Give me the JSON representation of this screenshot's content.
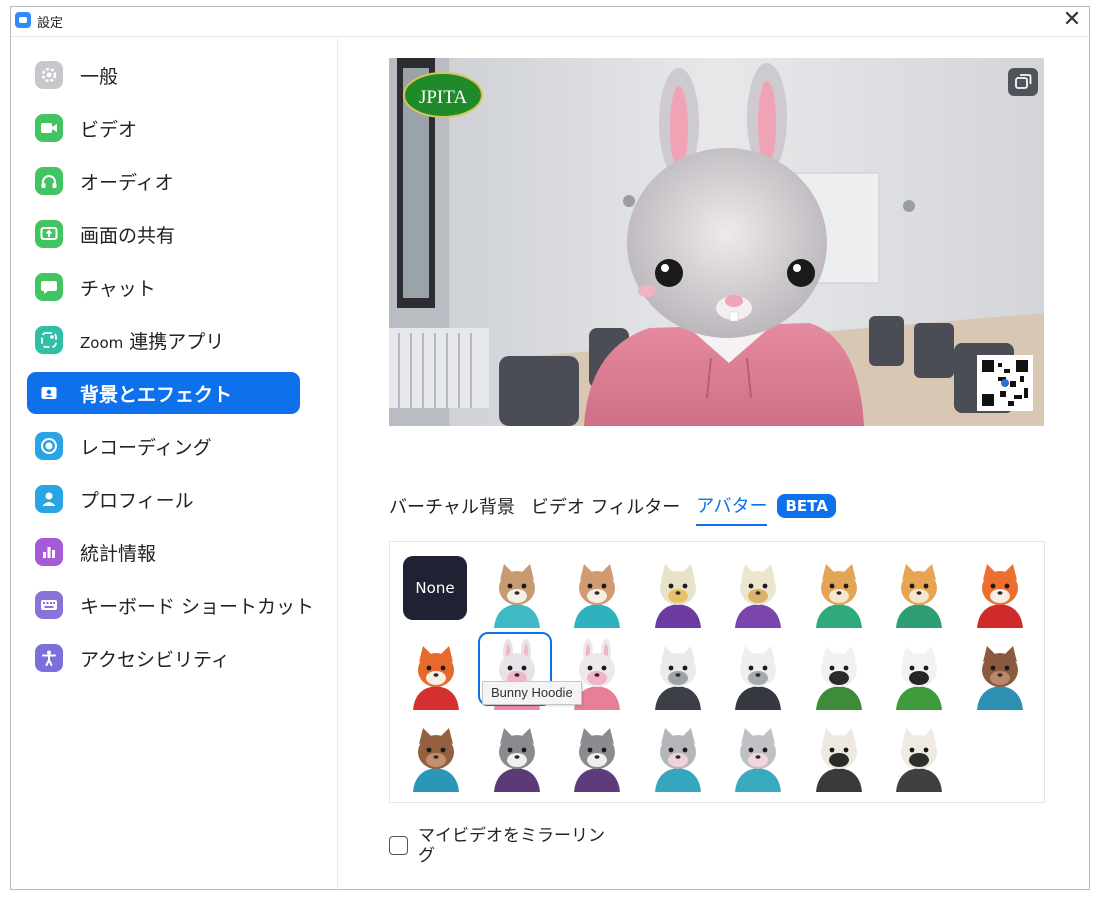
{
  "window": {
    "title": "設定",
    "close_glyph": "✕"
  },
  "sidebar": {
    "items": [
      {
        "id": "general",
        "label": "一般",
        "icon": "gear-icon",
        "color": "#c8c8cc"
      },
      {
        "id": "video",
        "label": "ビデオ",
        "icon": "video-camera-icon",
        "color": "#43c463"
      },
      {
        "id": "audio",
        "label": "オーディオ",
        "icon": "headphones-icon",
        "color": "#43c463"
      },
      {
        "id": "screen-share",
        "label": "画面の共有",
        "icon": "share-screen-icon",
        "color": "#43c463"
      },
      {
        "id": "chat",
        "label": "チャット",
        "icon": "chat-bubble-icon",
        "color": "#43c463"
      },
      {
        "id": "zoom-apps",
        "label_latin": "Zoom",
        "label": "連携アプリ",
        "icon": "apps-icon",
        "color": "#2fbfa6"
      },
      {
        "id": "background-effects",
        "label": "背景とエフェクト",
        "icon": "person-card-icon",
        "color": "#0e71eb",
        "active": true
      },
      {
        "id": "recording",
        "label": "レコーディング",
        "icon": "record-icon",
        "color": "#2ba4e6"
      },
      {
        "id": "profile",
        "label": "プロフィール",
        "icon": "profile-icon",
        "color": "#2ba4e6"
      },
      {
        "id": "statistics",
        "label": "統計情報",
        "icon": "bar-chart-icon",
        "color": "#a55bd6"
      },
      {
        "id": "keyboard-shortcuts",
        "label": "キーボード ショートカット",
        "icon": "keyboard-icon",
        "color": "#8a72d8"
      },
      {
        "id": "accessibility",
        "label": "アクセシビリティ",
        "icon": "accessibility-icon",
        "color": "#7b6fd9"
      }
    ]
  },
  "preview": {
    "logo_text": "JPITA",
    "pip_icon": "pip-toggle-icon"
  },
  "tabs": [
    {
      "label": "バーチャル背景",
      "active": false
    },
    {
      "label": "ビデオ フィルター",
      "active": false
    },
    {
      "label": "アバター",
      "active": true
    }
  ],
  "beta_label": "BETA",
  "avatars": {
    "none_label": "None",
    "tooltip": "Bunny Hoodie",
    "items": [
      {
        "name": "cat-teal",
        "fur": "#c79a72",
        "accent": "#f5f1ea",
        "top": "#3fb9c4"
      },
      {
        "name": "cat-teal-2",
        "fur": "#d19a70",
        "accent": "#f5efe6",
        "top": "#2eb2bd"
      },
      {
        "name": "cow-purple",
        "fur": "#e8e2c9",
        "accent": "#e9c06a",
        "top": "#6c3aa0"
      },
      {
        "name": "cow-purple-2",
        "fur": "#ece6cf",
        "accent": "#ddb26a",
        "top": "#7a46ad"
      },
      {
        "name": "dog-green",
        "fur": "#e2a556",
        "accent": "#f5e6cf",
        "top": "#2faa7a"
      },
      {
        "name": "dog-green-2",
        "fur": "#e7a451",
        "accent": "#f5e7cf",
        "top": "#2e9e74"
      },
      {
        "name": "fox-red",
        "fur": "#ec6f2e",
        "accent": "#f6efe6",
        "top": "#cf2b2b"
      },
      {
        "name": "fox-red-2",
        "fur": "#e8692c",
        "accent": "#f6efe6",
        "top": "#d33030"
      },
      {
        "name": "bunny-hoodie",
        "fur": "#e7e3e8",
        "accent": "#f3b8c8",
        "top": "#ee8aa3"
      },
      {
        "name": "bunny-pink",
        "fur": "#ece8ec",
        "accent": "#f2b3c4",
        "top": "#e97e99"
      },
      {
        "name": "polar-bear-dark",
        "fur": "#e9eaec",
        "accent": "#9ea3aa",
        "top": "#3c3f45"
      },
      {
        "name": "polar-bear-dark-2",
        "fur": "#eceef0",
        "accent": "#a5a9b0",
        "top": "#35383e"
      },
      {
        "name": "panda-green",
        "fur": "#f1f1f1",
        "accent": "#2a2a2a",
        "top": "#3e8c3a"
      },
      {
        "name": "panda-green-2",
        "fur": "#f2f2f2",
        "accent": "#262626",
        "top": "#3f9a3c"
      },
      {
        "name": "otter-teal",
        "fur": "#8a5a3e",
        "accent": "#b9886a",
        "top": "#2d8fb1"
      },
      {
        "name": "otter-teal-2",
        "fur": "#93613f",
        "accent": "#c2906c",
        "top": "#2b97b8"
      },
      {
        "name": "raccoon-purple",
        "fur": "#8c8a8f",
        "accent": "#f0efef",
        "top": "#5b3a77"
      },
      {
        "name": "raccoon-purple-2",
        "fur": "#8e8b90",
        "accent": "#efeeee",
        "top": "#5e3c7c"
      },
      {
        "name": "cat-gray-teal",
        "fur": "#b4b6ba",
        "accent": "#f1d1dc",
        "top": "#35a6bd"
      },
      {
        "name": "cat-gray-teal-2",
        "fur": "#bfc1c5",
        "accent": "#f3d4de",
        "top": "#3aaac1"
      },
      {
        "name": "cow-black",
        "fur": "#ede9df",
        "accent": "#2b2b2b",
        "top": "#3a3a3a"
      },
      {
        "name": "cow-black-2",
        "fur": "#efebe1",
        "accent": "#2e2e2e",
        "top": "#404040"
      }
    ]
  },
  "mirror": {
    "label": "マイビデオをミラーリング",
    "checked": false
  },
  "colors": {
    "accent": "#0e71eb",
    "sidebar_active_text": "#ffffff"
  }
}
